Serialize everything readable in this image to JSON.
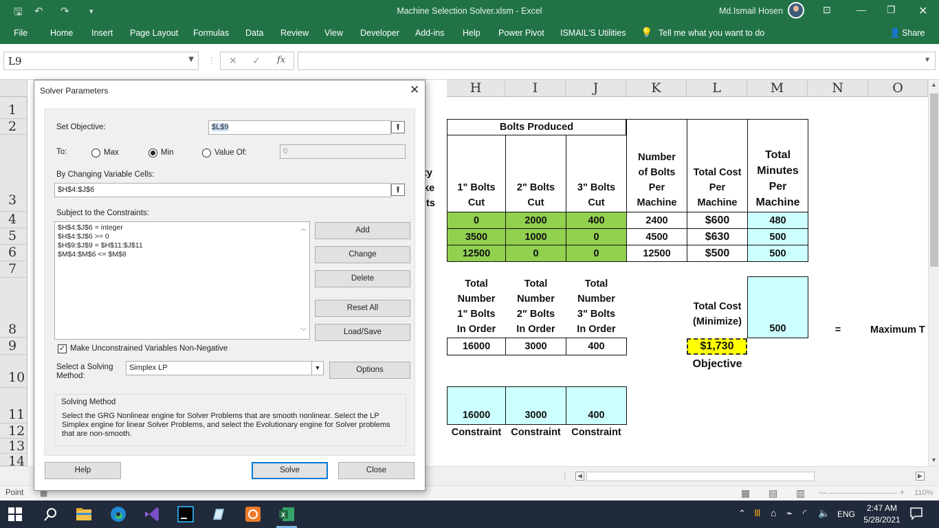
{
  "titlebar": {
    "title": "Machine Selection Solver.xlsm  -  Excel",
    "user": "Md.Ismail Hosen",
    "save_icon": "save-icon",
    "undo_icon": "undo-icon",
    "redo_icon": "redo-icon"
  },
  "ribbon": {
    "tabs": [
      "File",
      "Home",
      "Insert",
      "Page Layout",
      "Formulas",
      "Data",
      "Review",
      "View",
      "Developer",
      "Add-ins",
      "Help",
      "Power Pivot",
      "ISMAIL'S Utilities"
    ],
    "tell_me": "Tell me what you want to do",
    "share": "Share"
  },
  "formula_bar": {
    "name_box": "L9",
    "fx": "fx",
    "value": ""
  },
  "grid": {
    "columns": [
      "H",
      "I",
      "J",
      "K",
      "L",
      "M",
      "N",
      "O"
    ],
    "rows": [
      "1",
      "2",
      "3",
      "4",
      "5",
      "6",
      "7",
      "8",
      "9",
      "10",
      "11",
      "12",
      "13",
      "14"
    ],
    "header_bolts_produced": "Bolts Produced",
    "partial_header": [
      "ty",
      "ke",
      "its"
    ],
    "h_1bolts": "1\" Bolts Cut",
    "h_2bolts": "2\" Bolts Cut",
    "h_3bolts": "3\" Bolts Cut",
    "h_num_bolts": "Number of Bolts Per Machine",
    "h_total_cost": "Total Cost Per Machine",
    "h_total_minutes": "Total Minutes Per Machine",
    "data_rows": [
      {
        "c1": "0",
        "c2": "2000",
        "c3": "400",
        "num": "2400",
        "cost": "$600",
        "min": "480"
      },
      {
        "c1": "3500",
        "c2": "1000",
        "c3": "0",
        "num": "4500",
        "cost": "$630",
        "min": "500"
      },
      {
        "c1": "12500",
        "c2": "0",
        "c3": "0",
        "num": "12500",
        "cost": "$500",
        "min": "500"
      }
    ],
    "order_h1": "Total Number 1\" Bolts In Order",
    "order_h2": "Total Number 2\" Bolts In Order",
    "order_h3": "Total Number 3\" Bolts In Order",
    "total_cost_label": "Total Cost (Minimize)",
    "m8_value": "500",
    "equals": "=",
    "max_label": "Maximum T",
    "order_values": [
      "16000",
      "3000",
      "400"
    ],
    "objective_value": "$1,730",
    "objective_label": "Objective",
    "row11_values": [
      "16000",
      "3000",
      "400"
    ],
    "constraint_label": "Constraint"
  },
  "dialog": {
    "title": "Solver Parameters",
    "set_objective_label": "Set Objective:",
    "set_objective_value": "$L$9",
    "to_label": "To:",
    "max_label": "Max",
    "min_label": "Min",
    "value_of_label": "Value Of:",
    "value_of_value": "0",
    "changing_label": "By Changing Variable Cells:",
    "changing_value": "$H$4:$J$6",
    "constraints_label": "Subject to the Constraints:",
    "constraints": [
      "$H$4:$J$6 = integer",
      "$H$4:$J$6 >= 0",
      "$H$9:$J$9 = $H$11:$J$11",
      "$M$4:$M$6 <= $M$8"
    ],
    "add": "Add",
    "change": "Change",
    "delete": "Delete",
    "reset_all": "Reset All",
    "load_save": "Load/Save",
    "nonneg_label": "Make Unconstrained Variables Non-Negative",
    "nonneg_checked": true,
    "method_label_1": "Select a Solving",
    "method_label_2": "Method:",
    "method_value": "Simplex LP",
    "options": "Options",
    "group_title": "Solving Method",
    "group_text": "Select the GRG Nonlinear engine for Solver Problems that are smooth nonlinear. Select the LP Simplex engine for linear Solver Problems, and select the Evolutionary engine for Solver problems that are non-smooth.",
    "help": "Help",
    "solve": "Solve",
    "close": "Close"
  },
  "status_bar": {
    "mode": "Point",
    "zoom": "110%"
  },
  "taskbar": {
    "lang": "ENG",
    "time": "2:47 AM",
    "date": "5/28/2021"
  },
  "colors": {
    "excel_green": "#217346",
    "cell_green": "#92d050",
    "cell_cyan": "#ccffff",
    "objective_yellow": "#ffff00"
  }
}
